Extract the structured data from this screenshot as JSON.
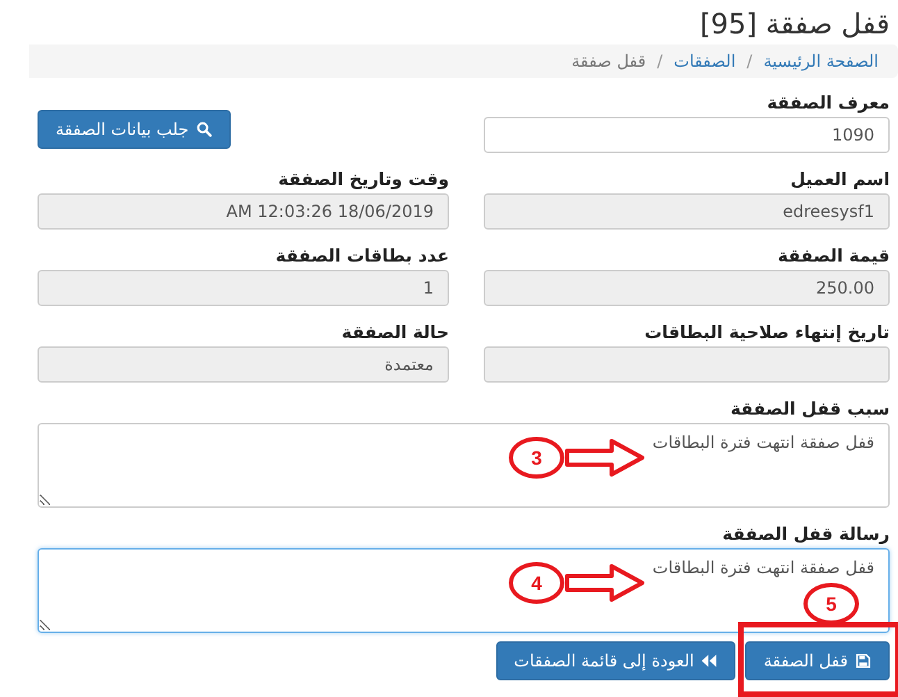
{
  "page": {
    "title": "قفل صفقة [95]"
  },
  "breadcrumb": [
    {
      "label": "الصفحة الرئيسية",
      "link": true,
      "separator": "/"
    },
    {
      "label": "الصفقات",
      "link": true,
      "separator": "/"
    },
    {
      "label": "قفل صفقة",
      "link": false
    }
  ],
  "rows": [
    [
      {
        "kind": "input",
        "label": "معرف الصفقة",
        "value": "1090",
        "readonly": false
      },
      {
        "kind": "button",
        "label": "جلب بيانات الصفقة"
      }
    ],
    [
      {
        "kind": "input",
        "label": "اسم العميل",
        "value": "edreesysf1",
        "readonly": true
      },
      {
        "kind": "input",
        "label": "وقت وتاريخ الصفقة",
        "value": "AM 12:03:26 18/06/2019",
        "readonly": true
      }
    ],
    [
      {
        "kind": "input",
        "label": "قيمة الصفقة",
        "value": "250.00",
        "readonly": true
      },
      {
        "kind": "input",
        "label": "عدد بطاقات الصفقة",
        "value": "1",
        "readonly": true
      }
    ],
    [
      {
        "kind": "input",
        "label": "تاريخ إنتهاء صلاحية البطاقات",
        "readonly": true
      },
      {
        "kind": "input",
        "label": "حالة الصفقة",
        "value": "معتمدة",
        "readonly": true
      }
    ]
  ],
  "textareas": [
    {
      "label": "سبب قفل الصفقة",
      "value": "قفل صفقة انتهت فترة البطاقات",
      "focused": false,
      "annotation": {
        "kind": "arrow",
        "number": "3"
      }
    },
    {
      "label": "رسالة قفل الصفقة",
      "value": "قفل صفقة انتهت فترة البطاقات",
      "focused": true,
      "annotation": {
        "kind": "arrow",
        "number": "4"
      }
    }
  ],
  "buttons": [
    {
      "kind": "submit",
      "label": "قفل الصفقة",
      "annotation": {
        "kind": "frame",
        "number": "5"
      }
    },
    {
      "kind": "back",
      "label": "العودة إلى قائمة الصفقات"
    }
  ]
}
